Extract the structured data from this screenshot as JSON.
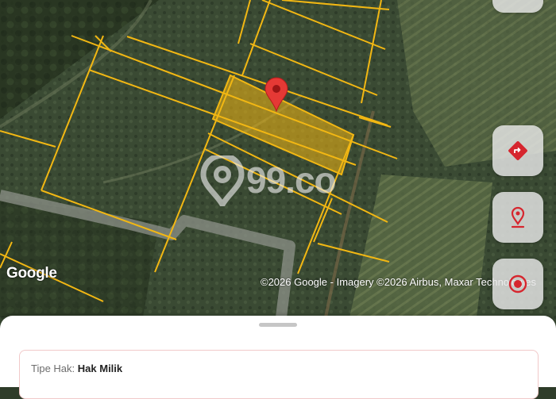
{
  "map": {
    "google_logo": "Google",
    "attribution": "©2026 Google - Imagery ©2026 Airbus, Maxar Technologies",
    "watermark": "99.co",
    "parcel_color": "#f2b713",
    "pin_color": "#e53935"
  },
  "controls": {
    "directions_icon": "directions-icon",
    "location_pin_icon": "location-pin-icon",
    "target_icon": "target-icon",
    "accent": "#d6262e"
  },
  "sheet": {
    "land_title_label": "Tipe Hak:",
    "land_title_value": "Hak Milik"
  }
}
